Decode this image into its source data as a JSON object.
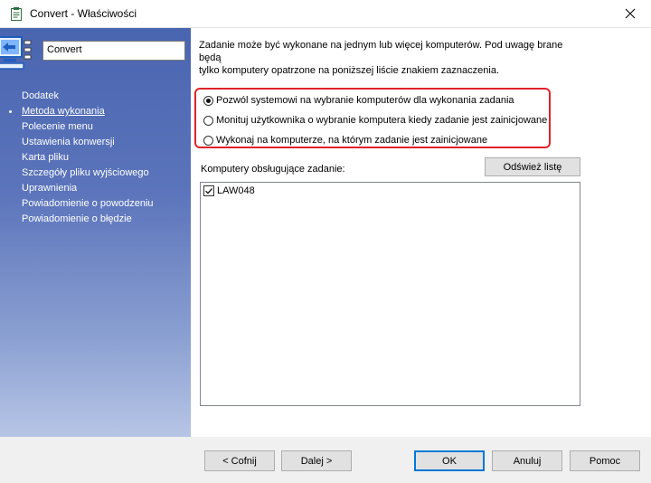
{
  "window": {
    "title": "Convert - Właściwości",
    "app_icon": "clipboard-app-icon",
    "close_icon": "close-icon"
  },
  "sidebar": {
    "logo_icon": "computer-task-icon",
    "name": "Convert",
    "items": [
      {
        "label": "Dodatek",
        "active": false
      },
      {
        "label": "Metoda wykonania",
        "active": true
      },
      {
        "label": "Polecenie menu",
        "active": false
      },
      {
        "label": "Ustawienia konwersji",
        "active": false
      },
      {
        "label": "Karta pliku",
        "active": false
      },
      {
        "label": "Szczegóły pliku wyjściowego",
        "active": false
      },
      {
        "label": "Uprawnienia",
        "active": false
      },
      {
        "label": "Powiadomienie o powodzeniu",
        "active": false
      },
      {
        "label": "Powiadomienie o błędzie",
        "active": false
      }
    ]
  },
  "content": {
    "description_line1": "Zadanie może być wykonane na jednym lub więcej komputerów. Pod uwagę brane będą",
    "description_line2": "tylko komputery opatrzone na poniższej liście znakiem zaznaczenia.",
    "options": [
      {
        "label": "Pozwól systemowi na wybranie komputerów dla wykonania zadania",
        "checked": true
      },
      {
        "label": "Monituj użytkownika o wybranie komputera kiedy zadanie jest zainicjowane",
        "checked": false
      },
      {
        "label": "Wykonaj na komputerze, na którym zadanie jest zainicjowane",
        "checked": false
      }
    ],
    "list_label": "Komputery obsługujące zadanie:",
    "refresh_button": "Odśwież listę",
    "computers": [
      {
        "name": "LAW048",
        "checked": true
      }
    ]
  },
  "footer": {
    "back": "< Cofnij",
    "next": "Dalej >",
    "ok": "OK",
    "cancel": "Anuluj",
    "help": "Pomoc"
  },
  "colors": {
    "sidebar_top": "#4a65b0",
    "sidebar_bottom": "#b7c5e6",
    "highlight_border": "#e0232a",
    "default_button_border": "#0078d7"
  }
}
